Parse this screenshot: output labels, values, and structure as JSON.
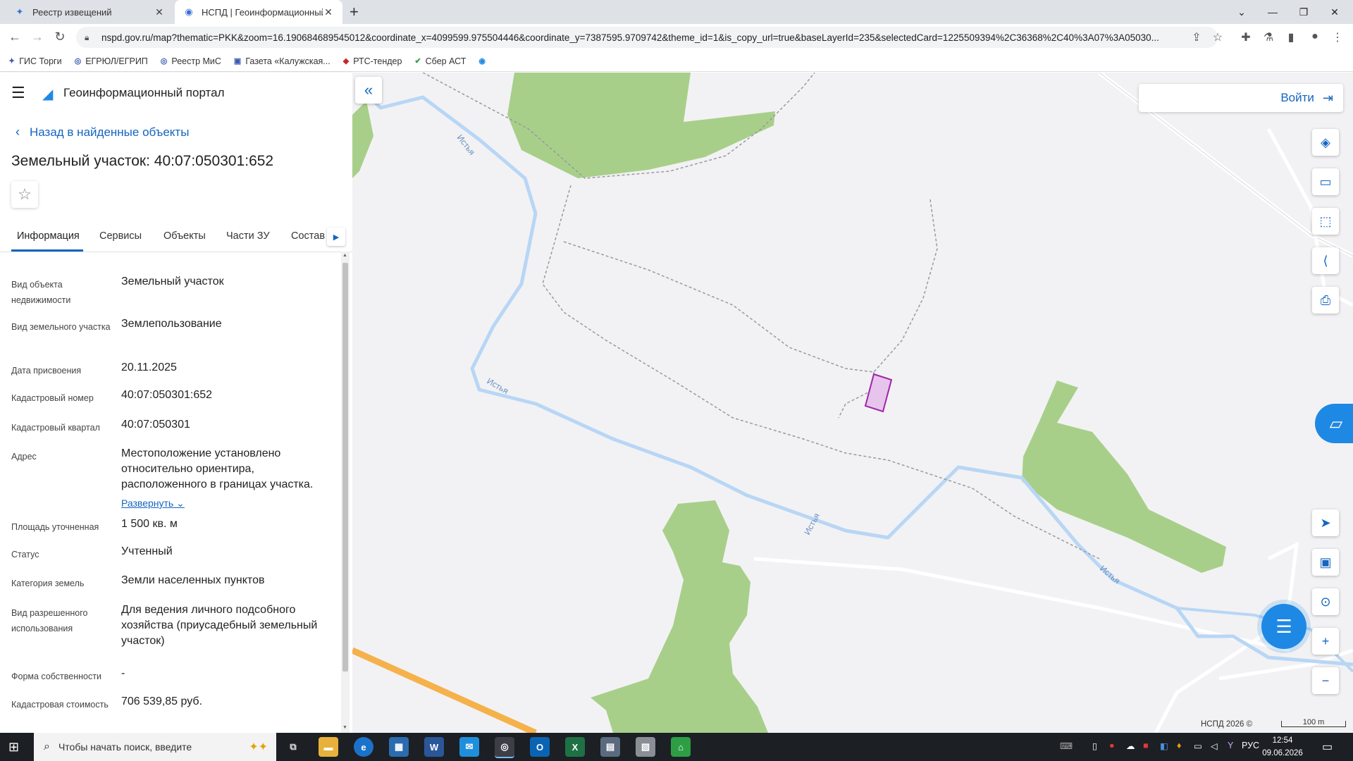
{
  "browser": {
    "tabs": [
      {
        "title": "Реестр извещений",
        "active": false
      },
      {
        "title": "НСПД | Геоинформационный п",
        "active": true
      }
    ],
    "url": "nspd.gov.ru/map?thematic=PKK&zoom=16.190684689545012&coordinate_x=4099599.975504446&coordinate_y=7387595.9709742&theme_id=1&is_copy_url=true&baseLayerId=235&selectedCard=1225509394%2C36368%2C40%3A07%3A05030...",
    "bookmarks": [
      "ГИС Торги",
      "ЕГРЮЛ/ЕГРИП",
      "Реестр МиС",
      "Газета «Калужская...",
      "РТС-тендер",
      "Сбер АСТ"
    ]
  },
  "panel": {
    "portal_title": "Геоинформационный портал",
    "back_label": "Назад в найденные объекты",
    "object_title": "Земельный участок: 40:07:050301:652",
    "tabs": [
      "Информация",
      "Сервисы",
      "Объекты",
      "Части ЗУ",
      "Состав"
    ],
    "properties": [
      {
        "label": "Вид объекта недвижимости",
        "value": "Земельный участок"
      },
      {
        "label": "Вид земельного участка",
        "value": "Землепользование"
      },
      {
        "label": "Дата присвоения",
        "value": "20.11.2025"
      },
      {
        "label": "Кадастровый номер",
        "value": "40:07:050301:652"
      },
      {
        "label": "Кадастровый квартал",
        "value": "40:07:050301"
      },
      {
        "label": "Адрес",
        "value": "Местоположение установлено относительно ориентира, расположенного в границах участка."
      },
      {
        "label": "Площадь уточненная",
        "value": "1 500 кв. м"
      },
      {
        "label": "Статус",
        "value": "Учтенный"
      },
      {
        "label": "Категория земель",
        "value": "Земли населенных пунктов"
      },
      {
        "label": "Вид разрешенного использования",
        "value": "Для ведения личного подсобного хозяйства (приусадебный земельный участок)"
      },
      {
        "label": "Форма собственности",
        "value": "-"
      },
      {
        "label": "Кадастровая стоимость",
        "value": "706 539,85 руб."
      }
    ],
    "expand_label": "Развернуть"
  },
  "map": {
    "login_label": "Войти",
    "river_labels": [
      "Истья",
      "Истья",
      "Истья",
      "Истья"
    ],
    "attribution": "НСПД 2026 ©",
    "scale_label": "100 m",
    "colors": {
      "forest": "#a8cf8a",
      "river": "#b8d6f5",
      "road": "#f5b14a",
      "parcel": "#e6c4ec",
      "parcel_border": "#a024a8",
      "accent": "#1565c0"
    }
  },
  "taskbar": {
    "search_placeholder": "Чтобы начать поиск, введите",
    "language": "РУС",
    "time": "12:54",
    "date": "09.06.2026"
  }
}
